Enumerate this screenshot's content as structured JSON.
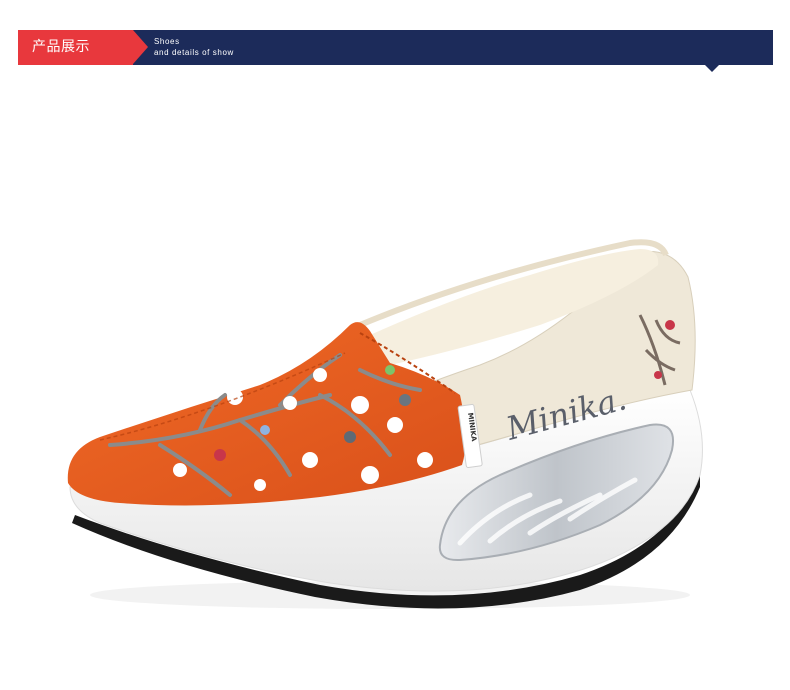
{
  "banner": {
    "tag_label": "产品展示",
    "subtitle_line1": "Shoes",
    "subtitle_line2": "and details of show",
    "colors": {
      "bar": "#1c2b5a",
      "tag": "#e8383d"
    }
  },
  "product": {
    "brand_print": "Minika.",
    "side_label": "MINIKA",
    "colors": {
      "upper": "#e85a1f",
      "heel_panel": "#efe8d8",
      "sole": "#ffffff",
      "air_cushion": "#cfd3d8"
    }
  }
}
